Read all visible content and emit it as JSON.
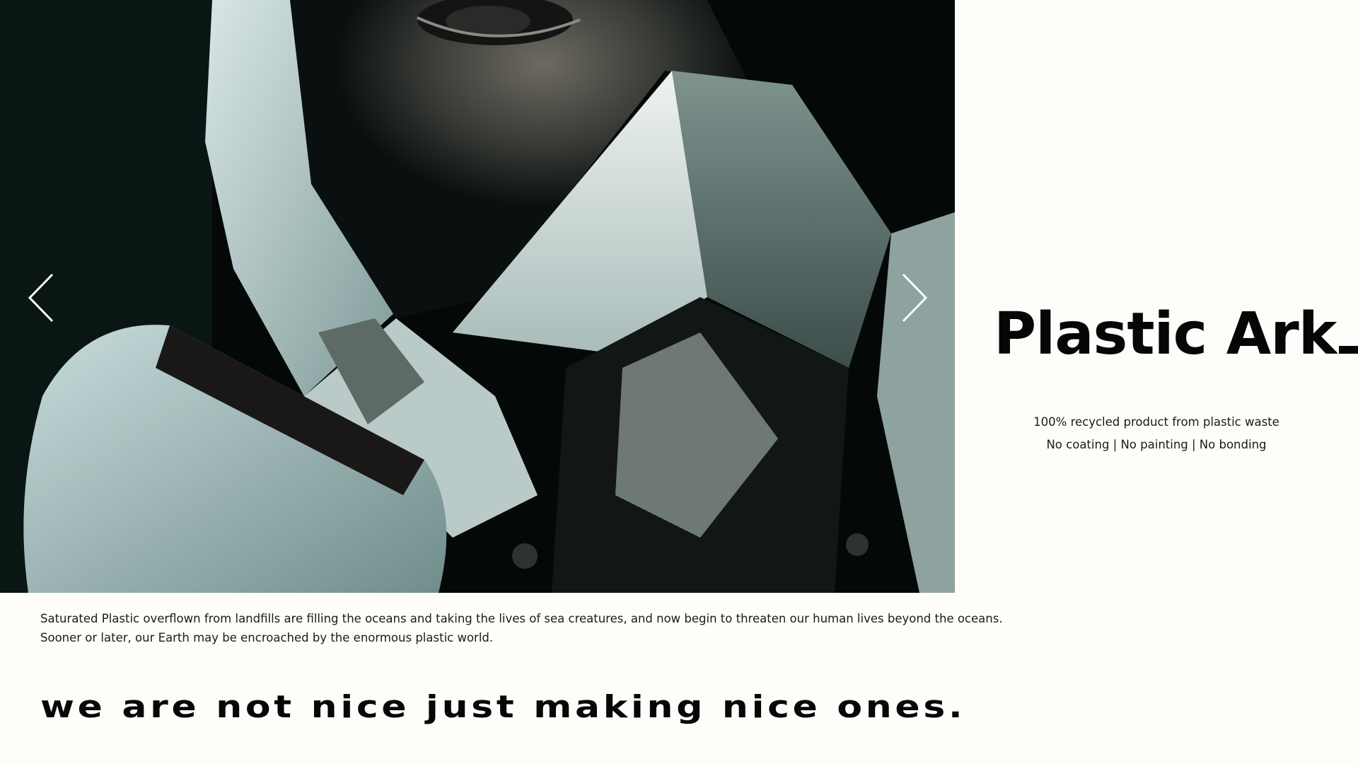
{
  "hero": {
    "image_description_icon": "respirator-portrait-photo",
    "prev_icon": "chevron-left-icon",
    "next_icon": "chevron-right-icon"
  },
  "brand": {
    "title": "Plastic Ark",
    "tagline_1": "100% recycled product from plastic waste",
    "tagline_2": "No coating | No painting | No bonding"
  },
  "description": {
    "line_1": "Saturated Plastic overflown from landfills are filling the oceans and taking the lives of sea creatures, and now begin to threaten our human lives beyond the oceans.",
    "line_2": "Sooner or later, our Earth may be encroached by the enormous plastic world."
  },
  "slogan": {
    "text": "we are not nice just making nice ones."
  },
  "colors": {
    "background": "#fffdfa",
    "text": "#070707",
    "photo_tint": "#2f5a52"
  }
}
